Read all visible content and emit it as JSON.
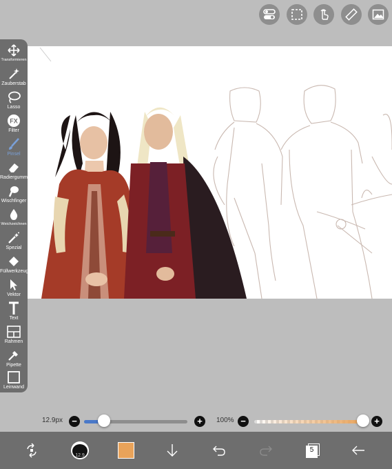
{
  "top_buttons": [
    {
      "name": "toggle-icon"
    },
    {
      "name": "selection-icon"
    },
    {
      "name": "hand-touch-icon"
    },
    {
      "name": "ruler-icon"
    },
    {
      "name": "image-icon"
    }
  ],
  "tools": [
    {
      "label": "Transformieren",
      "icon": "move-icon"
    },
    {
      "label": "Zauberstab",
      "icon": "magic-wand-icon"
    },
    {
      "label": "Lasso",
      "icon": "lasso-icon"
    },
    {
      "label": "Filter",
      "icon": "fx-icon"
    },
    {
      "label": "Pinsel",
      "icon": "brush-icon",
      "active": true
    },
    {
      "label": "Radiergummi",
      "icon": "eraser-icon"
    },
    {
      "label": "Wischfinger",
      "icon": "smudge-icon"
    },
    {
      "label": "Weichzeichnen",
      "icon": "blur-drop-icon"
    },
    {
      "label": "Spezial",
      "icon": "special-wand-icon"
    },
    {
      "label": "Füllwerkzeug",
      "icon": "fill-bucket-icon"
    },
    {
      "label": "Vektor",
      "icon": "vector-cursor-icon"
    },
    {
      "label": "Text",
      "icon": "text-icon"
    },
    {
      "label": "Rahmen",
      "icon": "frame-icon"
    },
    {
      "label": "Pipette",
      "icon": "eyedropper-icon"
    },
    {
      "label": "Leinwand",
      "icon": "canvas-icon"
    }
  ],
  "brush_size": {
    "value": "12.9px",
    "level": 0.19
  },
  "opacity": {
    "value": "100%",
    "level": 1.0
  },
  "colors": {
    "accent": "#4a79c9",
    "current_color": "#e9a35a",
    "toolbar": "#6d6d6d"
  },
  "bottom_bar": {
    "brush_thumb_size": "12.9",
    "layer_count": "5"
  }
}
